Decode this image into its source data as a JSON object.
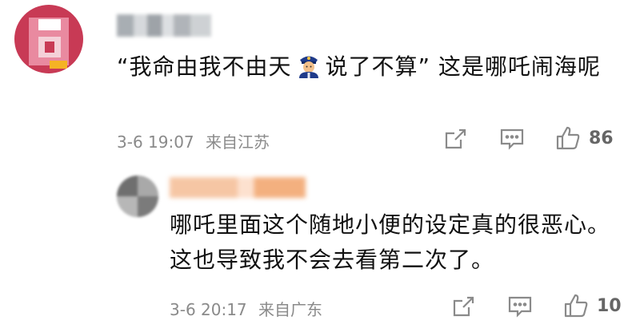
{
  "comment": {
    "quote_part1": "“我命由我不由天",
    "quote_part2": "说了不算”",
    "tail": " 这是哪吒闹海呢",
    "emoji_icon": "police-officer-emoji",
    "timestamp": "3-6 19:07",
    "location": "来自江苏",
    "likes": "86"
  },
  "reply": {
    "text": "哪吒里面这个随地小便的设定真的很恶心。这也导致我不会去看第二次了。",
    "timestamp": "3-6 20:17",
    "location": "来自广东",
    "likes": "10"
  },
  "colors": {
    "meta_text": "#8a8a8a",
    "body_text": "#111111",
    "avatar_accent": "#c83a55"
  }
}
